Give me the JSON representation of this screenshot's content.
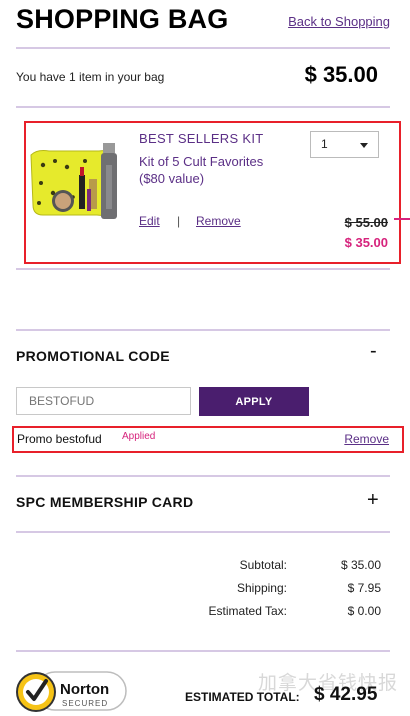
{
  "header": {
    "title": "SHOPPING BAG",
    "back_link": "Back to Shopping"
  },
  "summary": {
    "text": "You have 1 item in your bag",
    "total": "$ 35.00"
  },
  "item": {
    "name": "BEST SELLERS KIT",
    "description": "Kit of 5 Cult Favorites ($80 value)",
    "quantity": "1",
    "edit_label": "Edit",
    "separator": "|",
    "remove_label": "Remove",
    "original_price": "$ 55.00",
    "sale_price": "$ 35.00"
  },
  "promo": {
    "title": "PROMOTIONAL CODE",
    "toggle": "-",
    "input_placeholder": "BESTOFUD",
    "apply_label": "APPLY",
    "applied_code_label": "Promo bestofud",
    "applied_status": "Applied",
    "remove_label": "Remove"
  },
  "spc": {
    "title": "SPC MEMBERSHIP CARD",
    "toggle": "+"
  },
  "totals": {
    "subtotal_label": "Subtotal:",
    "subtotal_value": "$ 35.00",
    "shipping_label": "Shipping:",
    "shipping_value": "$ 7.95",
    "tax_label": "Estimated Tax:",
    "tax_value": "$ 0.00",
    "estimated_total_label": "ESTIMATED TOTAL:",
    "estimated_total_value": "$ 42.95"
  },
  "badge": {
    "brand": "Norton",
    "sub": "SECURED"
  },
  "watermark": "加拿大省钱快报",
  "colors": {
    "accent_purple": "#4a1e6e",
    "link_purple": "#5b2f86",
    "sale_pink": "#d6237c",
    "highlight_red": "#e8202a",
    "divider_lavender": "#d6c8e4"
  }
}
